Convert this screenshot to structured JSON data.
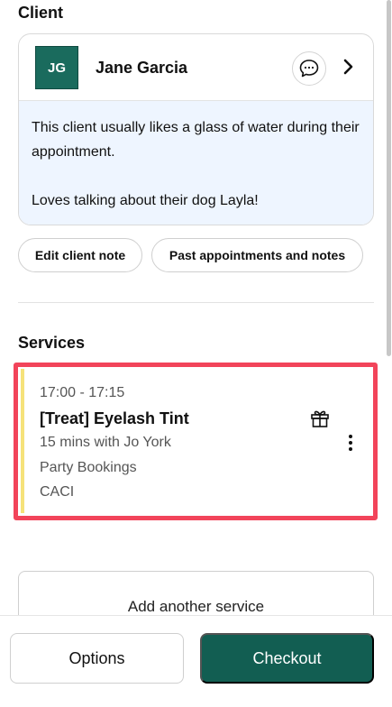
{
  "client": {
    "section_title": "Client",
    "initials": "JG",
    "name": "Jane Garcia",
    "note_line1": "This client usually likes a glass of water during their appointment.",
    "note_line2": "Loves talking about their dog Layla!",
    "edit_note_label": "Edit client note",
    "past_appointments_label": "Past appointments and notes"
  },
  "services": {
    "section_title": "Services",
    "items": [
      {
        "time": "17:00 - 17:15",
        "name": "[Treat] Eyelash Tint",
        "duration": "15 mins with Jo York",
        "tag1": "Party Bookings",
        "tag2": "CACI"
      }
    ],
    "add_label": "Add another service"
  },
  "footer": {
    "options_label": "Options",
    "checkout_label": "Checkout"
  },
  "colors": {
    "brand": "#125e52",
    "avatar_bg": "#1a6b5d",
    "highlight": "#f2445a",
    "note_bg": "#eef5ff",
    "service_accent": "#f6e27a"
  },
  "icons": [
    "chat-icon",
    "chevron-right-icon",
    "gift-icon",
    "more-vertical-icon"
  ]
}
